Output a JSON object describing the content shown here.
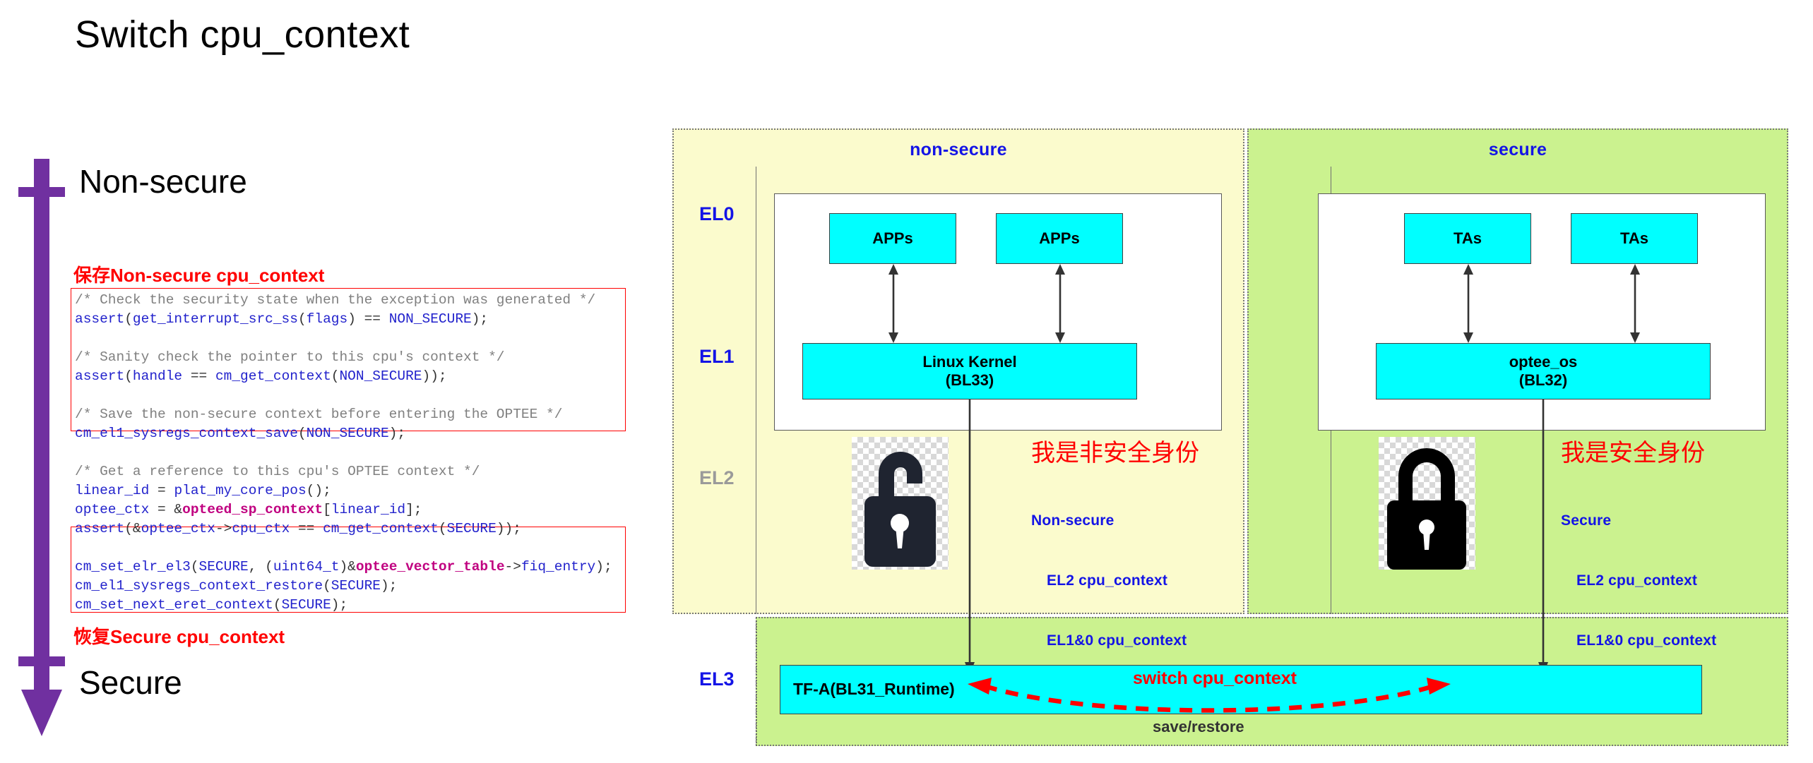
{
  "title": "Switch cpu_context",
  "left": {
    "nonsecure_heading": "Non-secure",
    "secure_heading": "Secure",
    "save_label": "保存Non-secure cpu_context",
    "restore_label": "恢复Secure cpu_context",
    "code_lines": [
      {
        "text": "/* Check the security state when the exception was generated */",
        "kind": "comment"
      },
      {
        "text": "assert(get_interrupt_src_ss(flags) == NON_SECURE);",
        "kind": "code"
      },
      {
        "text": "",
        "kind": "blank"
      },
      {
        "text": "/* Sanity check the pointer to this cpu's context */",
        "kind": "comment"
      },
      {
        "text": "assert(handle == cm_get_context(NON_SECURE));",
        "kind": "code"
      },
      {
        "text": "",
        "kind": "blank"
      },
      {
        "text": "/* Save the non-secure context before entering the OPTEE */",
        "kind": "comment"
      },
      {
        "text": "cm_el1_sysregs_context_save(NON_SECURE);",
        "kind": "code"
      },
      {
        "text": "",
        "kind": "blank"
      },
      {
        "text": "/* Get a reference to this cpu's OPTEE context */",
        "kind": "comment"
      },
      {
        "text": "linear_id = plat_my_core_pos();",
        "kind": "code"
      },
      {
        "text": "optee_ctx = &opteed_sp_context[linear_id];",
        "kind": "code-mag"
      },
      {
        "text": "assert(&optee_ctx->cpu_ctx == cm_get_context(SECURE));",
        "kind": "code"
      },
      {
        "text": "",
        "kind": "blank"
      },
      {
        "text": "cm_set_elr_el3(SECURE, (uint64_t)&optee_vector_table->fiq_entry);",
        "kind": "code-mag"
      },
      {
        "text": "cm_el1_sysregs_context_restore(SECURE);",
        "kind": "code"
      },
      {
        "text": "cm_set_next_eret_context(SECURE);",
        "kind": "code"
      }
    ]
  },
  "diagram": {
    "nonsecure_panel_title": "non-secure",
    "secure_panel_title": "secure",
    "levels": {
      "el0": "EL0",
      "el1": "EL1",
      "el2": "EL2",
      "el3": "EL3"
    },
    "nonsecure": {
      "app_left": "APPs",
      "app_right": "APPs",
      "kernel_line1": "Linux Kernel",
      "kernel_line2": "(BL33)",
      "identity_note": "我是非安全身份",
      "context_title": "Non-secure",
      "context_items": [
        "EL2 cpu_context",
        "EL1&0 cpu_context"
      ],
      "lock_state": "unlocked"
    },
    "secure": {
      "ta_left": "TAs",
      "ta_right": "TAs",
      "os_line1": "optee_os",
      "os_line2": "(BL32)",
      "identity_note": "我是安全身份",
      "context_title": "Secure",
      "context_items": [
        "EL2 cpu_context",
        "EL1&0 cpu_context"
      ],
      "lock_state": "locked"
    },
    "el3": {
      "box_label": "TF-A(BL31_Runtime)",
      "switch_label": "switch cpu_context",
      "save_restore_label": "save/restore"
    }
  },
  "colors": {
    "purple_arrow": "#7030A0",
    "red": "#FF0000",
    "blue_label": "#1414E6",
    "cyan_box": "#00FFFF",
    "nonsecure_panel": "#FBFBCD",
    "secure_panel": "#CBF28F",
    "gray_el2": "#9A9A9A"
  }
}
